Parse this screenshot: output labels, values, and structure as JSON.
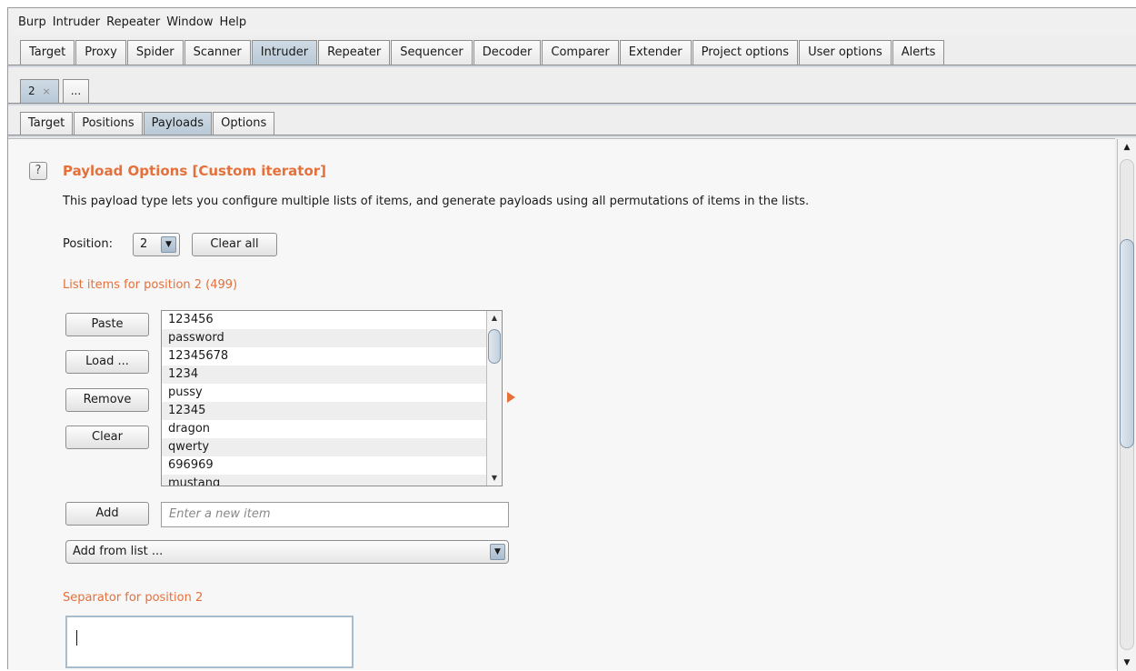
{
  "menu": [
    "Burp",
    "Intruder",
    "Repeater",
    "Window",
    "Help"
  ],
  "top_tabs": {
    "items": [
      "Target",
      "Proxy",
      "Spider",
      "Scanner",
      "Intruder",
      "Repeater",
      "Sequencer",
      "Decoder",
      "Comparer",
      "Extender",
      "Project options",
      "User options",
      "Alerts"
    ],
    "active": "Intruder"
  },
  "attack_tabs": {
    "tab_label": "2",
    "close_glyph": "×",
    "more_label": "..."
  },
  "inner_tabs": {
    "items": [
      "Target",
      "Positions",
      "Payloads",
      "Options"
    ],
    "active": "Payloads"
  },
  "payload_options": {
    "help_glyph": "?",
    "heading": "Payload Options [Custom iterator]",
    "description": "This payload type lets you configure multiple lists of items, and generate payloads using all permutations of items in the lists.",
    "position_label": "Position:",
    "position_value": "2",
    "clear_all_label": "Clear all",
    "list_label": "List items for position 2 (499)",
    "buttons": {
      "paste": "Paste",
      "load": "Load ...",
      "remove": "Remove",
      "clear": "Clear",
      "add": "Add"
    },
    "list_items": [
      "123456",
      "password",
      "12345678",
      "1234",
      "pussy",
      "12345",
      "dragon",
      "qwerty",
      "696969",
      "mustang"
    ],
    "new_item_placeholder": "Enter a new item",
    "add_from_list": "Add from list ...",
    "separator_label": "Separator for position 2",
    "separator_value": ""
  },
  "icons": {
    "dropdown": "chevron-down-icon",
    "scroll_up": "arrow-up-icon",
    "scroll_down": "arrow-down-icon",
    "help": "help-icon"
  },
  "colors": {
    "accent": "#e5703a",
    "active_tab": "#b8c8d6"
  }
}
